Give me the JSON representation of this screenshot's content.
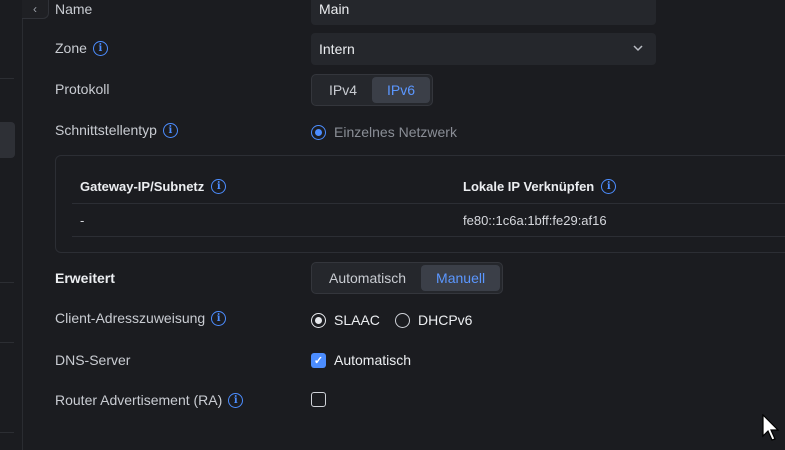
{
  "form": {
    "name": {
      "label": "Name",
      "value": "Main"
    },
    "zone": {
      "label": "Zone",
      "value": "Intern"
    },
    "protocol": {
      "label": "Protokoll",
      "options": [
        "IPv4",
        "IPv6"
      ],
      "selected": "IPv6"
    },
    "interface_type": {
      "label": "Schnittstellentyp",
      "option": "Einzelnes Netzwerk"
    },
    "table": {
      "headers": [
        "Gateway-IP/Subnetz",
        "Lokale IP Verknüpfen"
      ],
      "rows": [
        [
          "-",
          "fe80::1c6a:1bff:fe29:af16"
        ]
      ]
    },
    "advanced": {
      "label": "Erweitert",
      "options": [
        "Automatisch",
        "Manuell"
      ],
      "selected": "Manuell"
    },
    "client_addressing": {
      "label": "Client-Adresszuweisung",
      "options": [
        "SLAAC",
        "DHCPv6"
      ],
      "selected": "SLAAC"
    },
    "dns": {
      "label": "DNS-Server",
      "checkbox_label": "Automatisch",
      "checked": true
    },
    "ra": {
      "label": "Router Advertisement (RA)",
      "checked": false
    }
  },
  "icons": {
    "info": "i",
    "collapse": "‹",
    "chevron": "⌄"
  },
  "colors": {
    "accent": "#4c8dff",
    "background": "#1b1c20"
  }
}
